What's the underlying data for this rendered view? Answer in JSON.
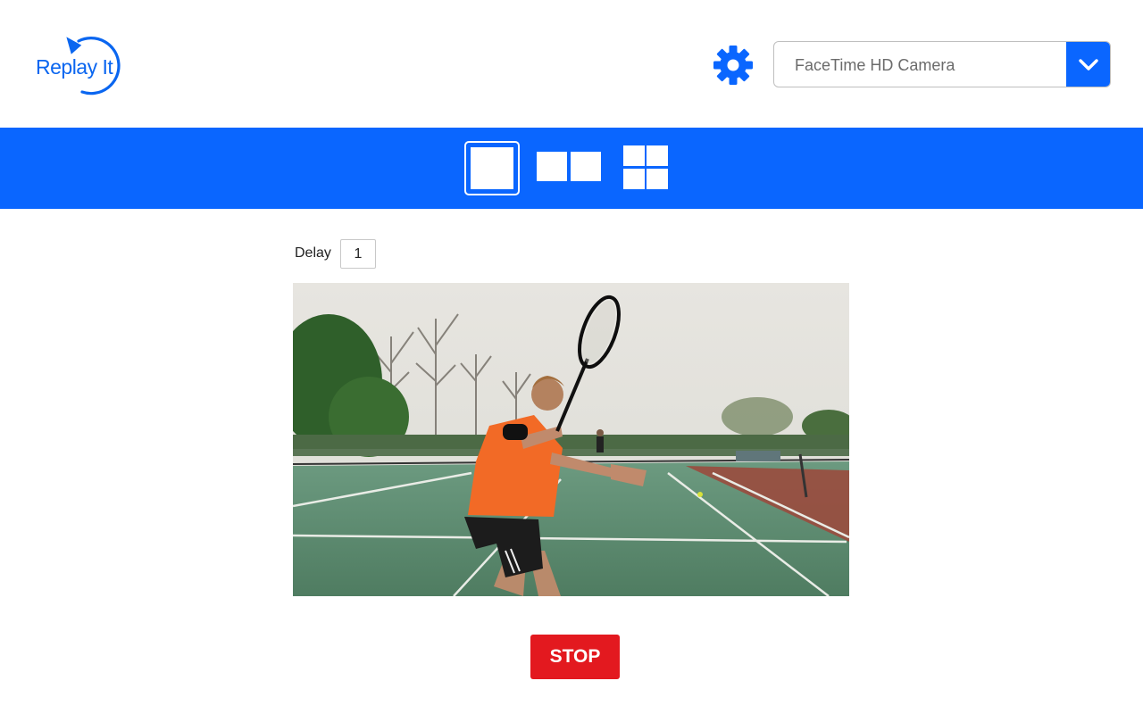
{
  "header": {
    "logo_text": "Replay It",
    "settings_icon": "gear-icon",
    "camera_select": {
      "selected": "FaceTime HD Camera",
      "toggle_icon": "chevron-down-icon"
    }
  },
  "layout_bar": {
    "options": [
      "single-view",
      "split-view",
      "quad-view"
    ],
    "selected": "single-view"
  },
  "controls": {
    "delay_label": "Delay",
    "delay_value": "1",
    "stop_label": "STOP"
  },
  "colors": {
    "accent": "#0a66ff",
    "stop": "#e3191f"
  }
}
